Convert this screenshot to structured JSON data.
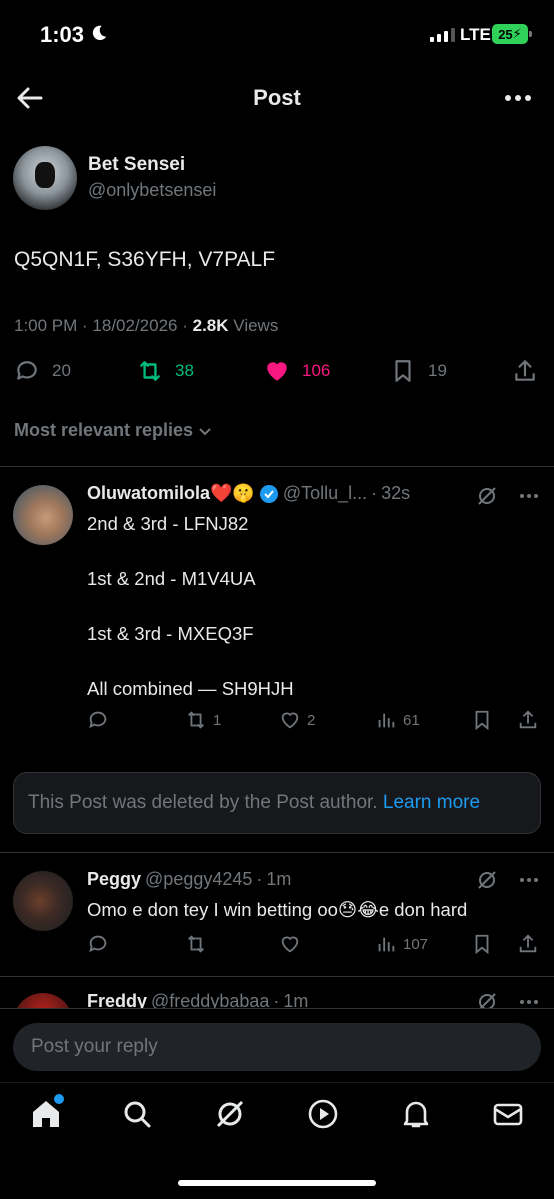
{
  "status_bar": {
    "time": "1:03",
    "network": "LTE",
    "battery": "25"
  },
  "nav": {
    "title": "Post"
  },
  "post": {
    "author_name": "Bet Sensei",
    "author_handle": "@onlybetsensei",
    "text": "Q5QN1F, S36YFH, V7PALF",
    "time": "1:00 PM",
    "date": "18/02/2026",
    "views_count": "2.8K",
    "views_label": "Views",
    "replies": "20",
    "reposts": "38",
    "likes": "106",
    "bookmarks": "19"
  },
  "replies_filter": "Most relevant replies",
  "replies": [
    {
      "name": "Oluwatomilola❤️🤫",
      "handle": "@Tollu_l...",
      "time": "32s",
      "lines": [
        "2nd & 3rd - LFNJ82",
        "1st & 2nd - M1V4UA",
        "1st & 3rd - MXEQ3F",
        "All combined — SH9HJH"
      ],
      "replies": "",
      "reposts": "1",
      "likes": "2",
      "views": "61"
    },
    {
      "name": "Peggy",
      "handle": "@peggy4245",
      "time": "1m",
      "text": "Omo e don tey I win betting oo😓😂e don hard",
      "replies": "",
      "reposts": "",
      "likes": "",
      "views": "107"
    },
    {
      "name": "Freddy",
      "handle": "@freddybabaa",
      "time": "1m"
    }
  ],
  "deleted_notice": {
    "text": "This Post was deleted by the Post author.",
    "link": "Learn more"
  },
  "reply_input": {
    "placeholder": "Post your reply"
  },
  "colors": {
    "accent": "#1d9bf0",
    "like": "#f91880",
    "repost": "#00ba7c",
    "muted": "#71767b"
  }
}
